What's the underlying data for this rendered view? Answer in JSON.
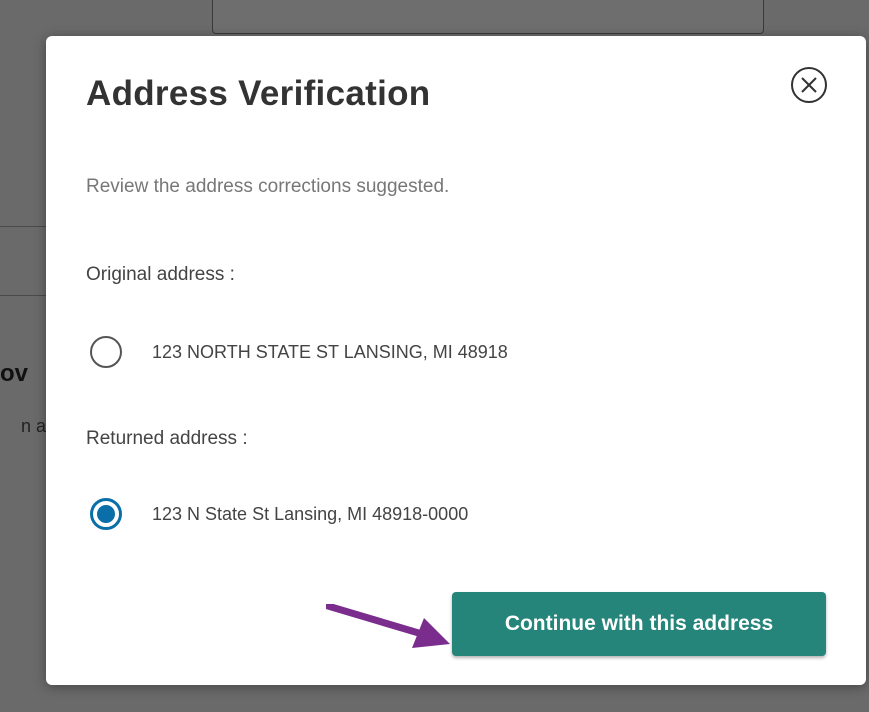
{
  "modal": {
    "title": "Address Verification",
    "subtitle": "Review the address corrections suggested.",
    "original_label": "Original address :",
    "original_address": "123 NORTH STATE ST LANSING, MI 48918",
    "returned_label": "Returned address :",
    "returned_address": "123 N State St Lansing, MI 48918-0000",
    "selected_option": "returned",
    "continue_label": "Continue with this address",
    "close_icon": "close-circle-icon"
  },
  "background": {
    "fragment_1": "ov",
    "fragment_2": "n a"
  },
  "colors": {
    "primary_button": "#26857a",
    "radio_selected": "#0a6fa8",
    "annotation_arrow": "#7b2d8e",
    "overlay": "#5b5b5b"
  }
}
